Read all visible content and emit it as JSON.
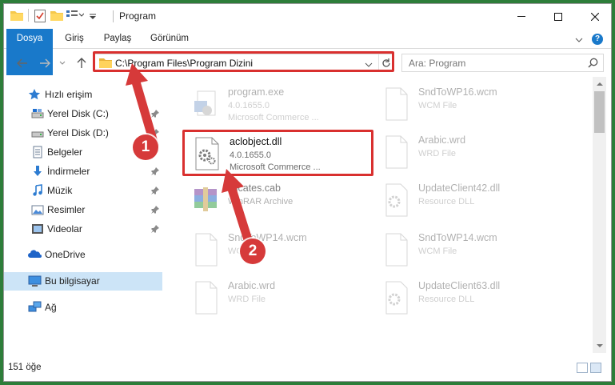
{
  "window": {
    "title": "Program",
    "minimize": "minimize",
    "maximize": "maximize",
    "close": "close"
  },
  "ribbon": {
    "tabs": [
      "Dosya",
      "Giriş",
      "Paylaş",
      "Görünüm"
    ],
    "help": "?"
  },
  "address": {
    "path": "C:\\Program Files\\Program Dizini",
    "search_placeholder": "Ara: Program"
  },
  "nav": {
    "items": [
      {
        "label": "Hızlı erişim",
        "icon": "star-icon"
      },
      {
        "label": "Yerel Disk (C:)",
        "icon": "drive-icon",
        "pinned": true
      },
      {
        "label": "Yerel Disk (D:)",
        "icon": "drive-icon",
        "pinned": true
      },
      {
        "label": "Belgeler",
        "icon": "documents-icon",
        "pinned": true
      },
      {
        "label": "İndirmeler",
        "icon": "download-icon",
        "pinned": true
      },
      {
        "label": "Müzik",
        "icon": "music-icon",
        "pinned": true
      },
      {
        "label": "Resimler",
        "icon": "pictures-icon",
        "pinned": true
      },
      {
        "label": "Videolar",
        "icon": "videos-icon",
        "pinned": true
      },
      {
        "label": "OneDrive",
        "icon": "onedrive-icon"
      },
      {
        "label": "Bu bilgisayar",
        "icon": "computer-icon",
        "selected": true
      },
      {
        "label": "Ağ",
        "icon": "network-icon"
      }
    ]
  },
  "files": [
    {
      "name": "program.exe",
      "line1": "4.0.1655.0",
      "line2": "Microsoft Commerce ...",
      "icon": "exe-icon",
      "faded": true
    },
    {
      "name": "SndToWP16.wcm",
      "line1": "WCM File",
      "line2": "",
      "icon": "file-icon",
      "faded": true
    },
    {
      "name": "aclobject.dll",
      "line1": "4.0.1655.0",
      "line2": "Microsoft Commerce ...",
      "icon": "dll-gear-icon",
      "faded": false
    },
    {
      "name": "Arabic.wrd",
      "line1": "WRD File",
      "line2": "",
      "icon": "file-icon",
      "faded": true
    },
    {
      "name": "tificates.cab",
      "line1": "WinRAR Archive",
      "line2": "",
      "icon": "winrar-icon",
      "faded": true
    },
    {
      "name": "UpdateClient42.dll",
      "line1": "Resource DLL",
      "line2": "",
      "icon": "dll-gear-icon",
      "faded": true
    },
    {
      "name": "SndToWP14.wcm",
      "line1": "WCM File",
      "line2": "",
      "icon": "file-icon",
      "faded": true
    },
    {
      "name": "SndToWP14.wcm",
      "line1": "WCM File",
      "line2": "",
      "icon": "file-icon",
      "faded": true
    },
    {
      "name": "Arabic.wrd",
      "line1": "WRD File",
      "line2": "",
      "icon": "file-icon",
      "faded": true
    },
    {
      "name": "UpdateClient63.dll",
      "line1": "Resource DLL",
      "line2": "",
      "icon": "dll-gear-icon",
      "faded": true
    }
  ],
  "status": {
    "count": "151 öğe"
  },
  "annotations": {
    "step1": "1",
    "step2": "2"
  },
  "colors": {
    "accent": "#1979ca",
    "highlight_red": "#d9302f",
    "selection": "#cce4f7",
    "desktop": "#2e7d3a"
  }
}
